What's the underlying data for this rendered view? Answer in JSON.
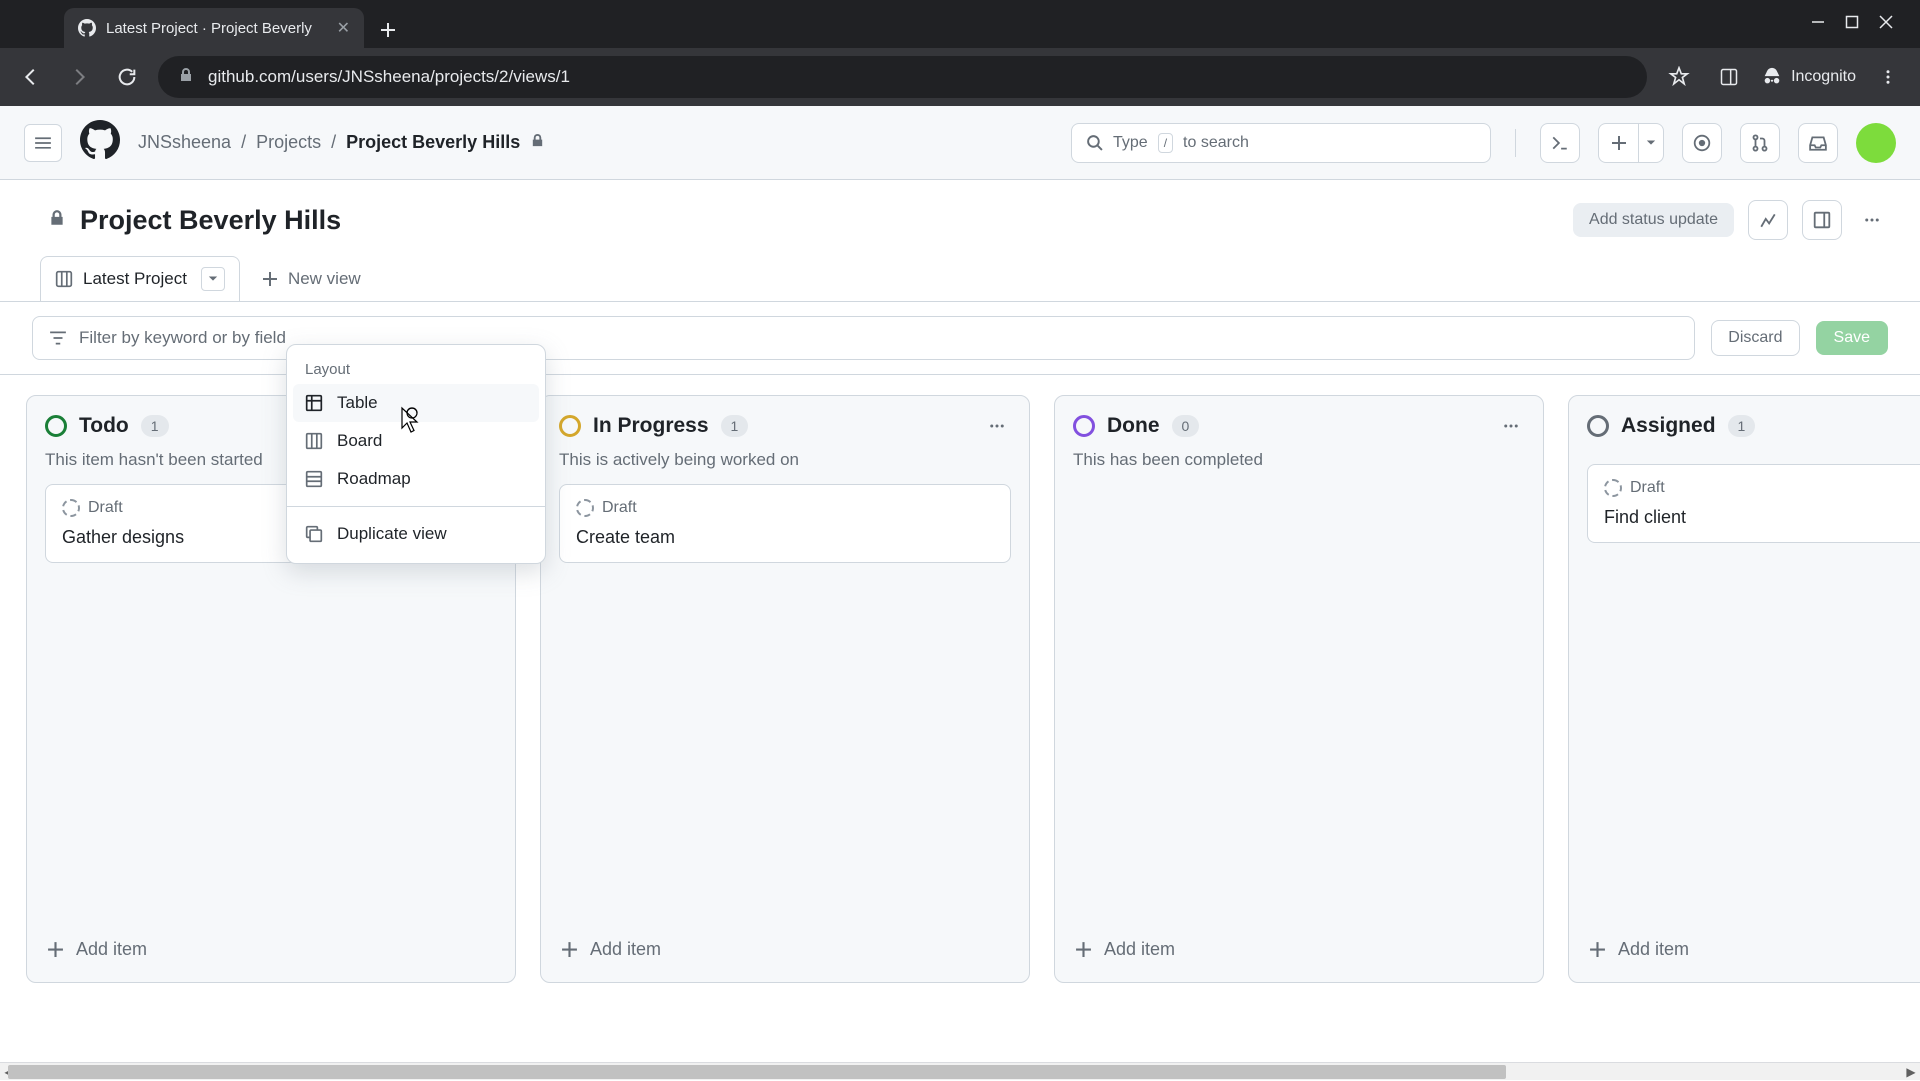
{
  "browser": {
    "tab_title": "Latest Project · Project Beverly",
    "url": "github.com/users/JNSsheena/projects/2/views/1",
    "incognito_label": "Incognito"
  },
  "header": {
    "breadcrumb_user": "JNSsheena",
    "breadcrumb_projects": "Projects",
    "breadcrumb_current": "Project Beverly Hills",
    "search_placeholder_pre": "Type",
    "search_placeholder_key": "/",
    "search_placeholder_post": "to search"
  },
  "project": {
    "title": "Project Beverly Hills",
    "status_button": "Add status update"
  },
  "views": {
    "active_tab": "Latest Project",
    "new_view": "New view"
  },
  "filter": {
    "placeholder": "Filter by keyword or by field",
    "discard": "Discard",
    "save": "Save"
  },
  "dropdown": {
    "section": "Layout",
    "table": "Table",
    "board": "Board",
    "roadmap": "Roadmap",
    "duplicate": "Duplicate view"
  },
  "columns": [
    {
      "title": "Todo",
      "count": "1",
      "desc": "This item hasn't been started",
      "status": "todo",
      "cards": [
        {
          "draft": "Draft",
          "title": "Gather designs"
        }
      ],
      "add": "Add item"
    },
    {
      "title": "In Progress",
      "count": "1",
      "desc": "This is actively being worked on",
      "status": "progress",
      "cards": [
        {
          "draft": "Draft",
          "title": "Create team"
        }
      ],
      "add": "Add item"
    },
    {
      "title": "Done",
      "count": "0",
      "desc": "This has been completed",
      "status": "done",
      "cards": [],
      "add": "Add item"
    },
    {
      "title": "Assigned",
      "count": "1",
      "desc": "",
      "status": "assigned",
      "cards": [
        {
          "draft": "Draft",
          "title": "Find client"
        }
      ],
      "add": "Add item"
    }
  ]
}
